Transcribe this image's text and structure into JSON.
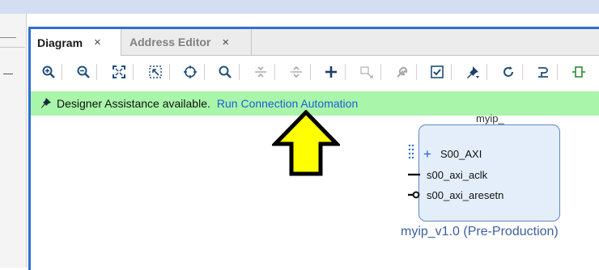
{
  "tabs": [
    {
      "label": "Diagram",
      "close": "×",
      "active": true
    },
    {
      "label": "Address Editor",
      "close": "×",
      "active": false
    }
  ],
  "toolbar": {
    "icons": [
      "zoom-in-icon",
      "zoom-out-icon",
      "fit-view-icon",
      "zoom-area-icon",
      "center-icon",
      "search-icon",
      "collapse-icon",
      "expand-icon",
      "add-ip-icon",
      "make-connection-icon",
      "wrench-icon",
      "validate-icon",
      "pin-icon",
      "refresh-icon",
      "regenerate-layout-icon",
      "ports-icon"
    ]
  },
  "banner": {
    "message": "Designer Assistance available.",
    "link": "Run Connection Automation",
    "background": "#a9f5a9",
    "link_color": "#1d5fd6"
  },
  "block": {
    "title_fragment": "myip_",
    "ports": [
      {
        "label": "S00_AXI",
        "symbol": "+"
      },
      {
        "label": "s00_axi_aclk"
      },
      {
        "label": "s00_axi_aresetn"
      }
    ],
    "caption": "myip_v1.0 (Pre-Production)"
  },
  "colors": {
    "accent": "#2f6fd0",
    "block_fill": "#e4eefb",
    "block_border": "#5f87c6",
    "arrow_fill": "#ffff00"
  }
}
